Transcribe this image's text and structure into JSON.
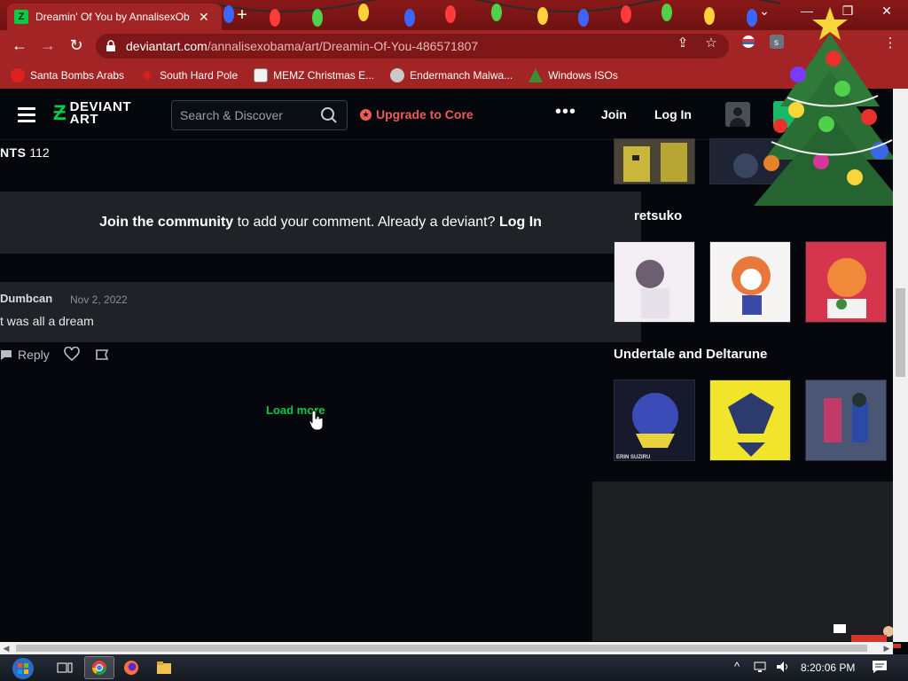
{
  "browser": {
    "tab_title": "Dreamin' Of You by AnnalisexOb",
    "tab_close": "✕",
    "new_tab": "+",
    "window_controls": {
      "chevron": "⌄",
      "minimize": "—",
      "maximize": "❐",
      "close": "✕"
    },
    "nav": {
      "back": "←",
      "forward": "→",
      "reload": "↻"
    },
    "url_host": "deviantart.com",
    "url_path": "/annalisexobama/art/Dreamin-Of-You-486571807",
    "menu": "⋮",
    "bookmarks": [
      {
        "label": "Santa Bombs Arabs",
        "icon": "santa-icon",
        "color": "#e0201f"
      },
      {
        "label": "South Hard Pole",
        "icon": "snowflake-icon",
        "color": "#e0201f"
      },
      {
        "label": "MEMZ Christmas E...",
        "icon": "memz-icon",
        "color": "#f2f2f2"
      },
      {
        "label": "Endermanch Malwa...",
        "icon": "raccoon-icon",
        "color": "#c8c8c8"
      },
      {
        "label": "Windows ISOs",
        "icon": "tree-icon",
        "color": "#3c8d2f"
      }
    ]
  },
  "header": {
    "logo_top": "DEVIANT",
    "logo_bottom": "ART",
    "search_placeholder": "Search & Discover",
    "upgrade_label": "Upgrade to Core",
    "more": "•••",
    "join_label": "Join",
    "login_label": "Log In"
  },
  "comments": {
    "count_label": "NTS",
    "count": "112",
    "join_box": {
      "strong": "Join the community",
      "middle": " to add your comment. Already a deviant? ",
      "login": "Log In"
    },
    "items": [
      {
        "author": "Dumbcan",
        "date": "Nov 2, 2022",
        "text": "t was all a dream"
      }
    ],
    "reply_label": "Reply",
    "load_more": "Load more"
  },
  "sidebar": {
    "sections": [
      {
        "title": "retsuko"
      },
      {
        "title": "Undertale and Deltarune"
      }
    ],
    "thumb_caption": "ERIN SUZIRU"
  },
  "taskbar": {
    "clock": "8:20:06 PM",
    "tray_up": "^"
  },
  "colors": {
    "da_green": "#05cc47",
    "upgrade_red": "#ef5c57",
    "chrome_red": "#a32424"
  }
}
